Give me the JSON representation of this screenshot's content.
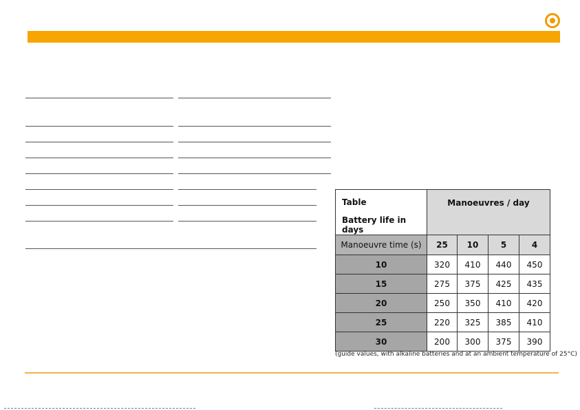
{
  "colors": {
    "brand_orange": "#f7a500",
    "header_gray": "#d9d9d9",
    "rowhead_gray": "#a6a6a6"
  },
  "logo_icon": "target-icon",
  "table": {
    "title_line1": "Table",
    "title_line2": "Battery life in days",
    "group_header": "Manoeuvres / day",
    "row_header_label": "Manoeuvre time (s)",
    "columns": [
      "25",
      "10",
      "5",
      "4"
    ],
    "rows": [
      {
        "time": "10",
        "values": [
          "320",
          "410",
          "440",
          "450"
        ]
      },
      {
        "time": "15",
        "values": [
          "275",
          "375",
          "425",
          "435"
        ]
      },
      {
        "time": "20",
        "values": [
          "250",
          "350",
          "410",
          "420"
        ]
      },
      {
        "time": "25",
        "values": [
          "220",
          "325",
          "385",
          "410"
        ]
      },
      {
        "time": "30",
        "values": [
          "200",
          "300",
          "375",
          "390"
        ]
      }
    ],
    "note": "(guide values, with alkaline batteries and at an ambient temperature of 25°C)"
  }
}
